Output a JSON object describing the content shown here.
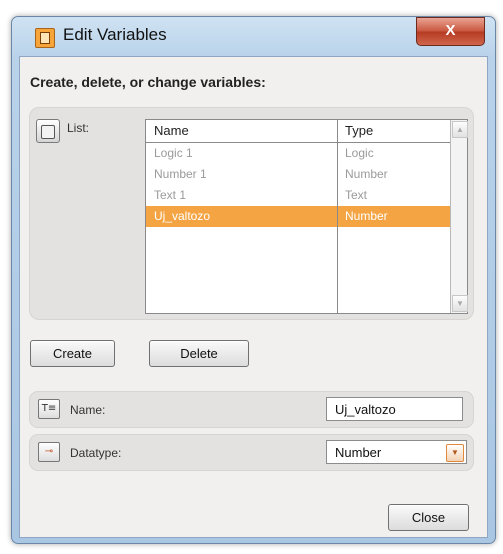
{
  "window": {
    "title": "Edit Variables",
    "close_glyph": "X"
  },
  "heading": "Create, delete, or change variables:",
  "list": {
    "label": "List:",
    "columns": [
      "Name",
      "Type"
    ],
    "rows": [
      {
        "name": "Logic 1",
        "type": "Logic"
      },
      {
        "name": "Number 1",
        "type": "Number"
      },
      {
        "name": "Text 1",
        "type": "Text"
      },
      {
        "name": "Uj_valtozo",
        "type": "Number"
      }
    ],
    "selected_index": 3
  },
  "buttons": {
    "create": "Create",
    "delete": "Delete",
    "close": "Close"
  },
  "name_field": {
    "label": "Name:",
    "value": "Uj_valtozo",
    "icon": "text-field-icon"
  },
  "datatype_field": {
    "label": "Datatype:",
    "value": "Number",
    "icon": "datatype-icon"
  },
  "colors": {
    "accent": "#f4a443",
    "title_icon": "#f7a43a",
    "close_button": "#c9553d"
  }
}
